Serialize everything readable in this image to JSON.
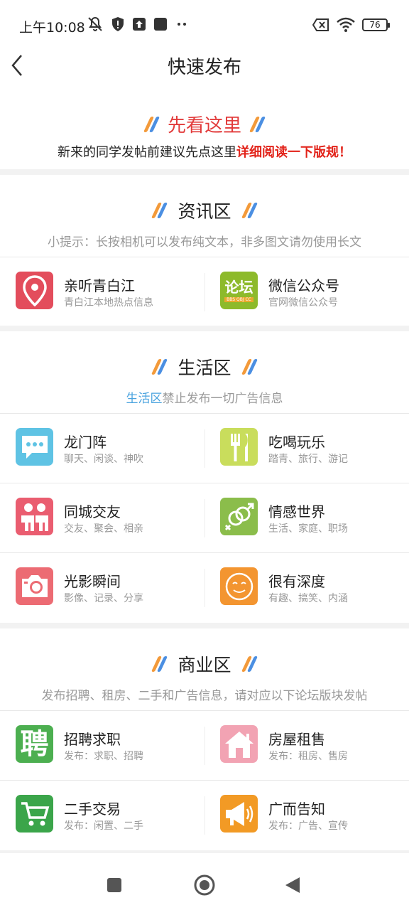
{
  "status": {
    "time": "上午10:08",
    "battery": "76"
  },
  "header": {
    "title": "快速发布"
  },
  "notice": {
    "title": "先看这里",
    "text_plain": "新来的同学发帖前建议先点这里",
    "text_highlight": "详细阅读一下版规！"
  },
  "sections": [
    {
      "title": "资讯区",
      "tip_plain": "小提示：长按相机可以发布纯文本，非多图文请勿使用长文",
      "items": [
        {
          "name": "亲听青白江",
          "desc": "青白江本地热点信息",
          "icon": "location-pin-icon"
        },
        {
          "name": "微信公众号",
          "desc": "官网微信公众号",
          "icon": "forum-logo-icon",
          "icon_text": "论坛",
          "icon_subtext": "BBS QBJ CC"
        }
      ]
    },
    {
      "title": "生活区",
      "tip_highlight": "生活区",
      "tip_plain": "禁止发布一切广告信息",
      "items": [
        {
          "name": "龙门阵",
          "desc": "聊天、闲谈、神吹",
          "icon": "chat-bubble-icon"
        },
        {
          "name": "吃喝玩乐",
          "desc": "踏青、旅行、游记",
          "icon": "fork-knife-icon"
        },
        {
          "name": "同城交友",
          "desc": "交友、聚会、相亲",
          "icon": "people-icon"
        },
        {
          "name": "情感世界",
          "desc": "生活、家庭、职场",
          "icon": "gender-symbols-icon"
        },
        {
          "name": "光影瞬间",
          "desc": "影像、记录、分享",
          "icon": "camera-icon"
        },
        {
          "name": "很有深度",
          "desc": "有趣、搞笑、内涵",
          "icon": "smiley-face-icon"
        }
      ]
    },
    {
      "title": "商业区",
      "tip_plain": "发布招聘、租房、二手和广告信息，请对应以下论坛版块发帖",
      "items": [
        {
          "name": "招聘求职",
          "desc": "发布：求职、招聘",
          "icon": "hire-character-icon",
          "icon_text": "聘"
        },
        {
          "name": "房屋租售",
          "desc": "发布：租房、售房",
          "icon": "house-icon"
        },
        {
          "name": "二手交易",
          "desc": "发布：闲置、二手",
          "icon": "shopping-cart-icon"
        },
        {
          "name": "广而告知",
          "desc": "发布：广告、宣传",
          "icon": "megaphone-icon"
        }
      ]
    }
  ],
  "colors": {
    "accent_red": "#e2231a",
    "accent_blue": "#4aa3df",
    "slash_orange": "#f39a3a",
    "slash_blue": "#4b8fe2"
  }
}
